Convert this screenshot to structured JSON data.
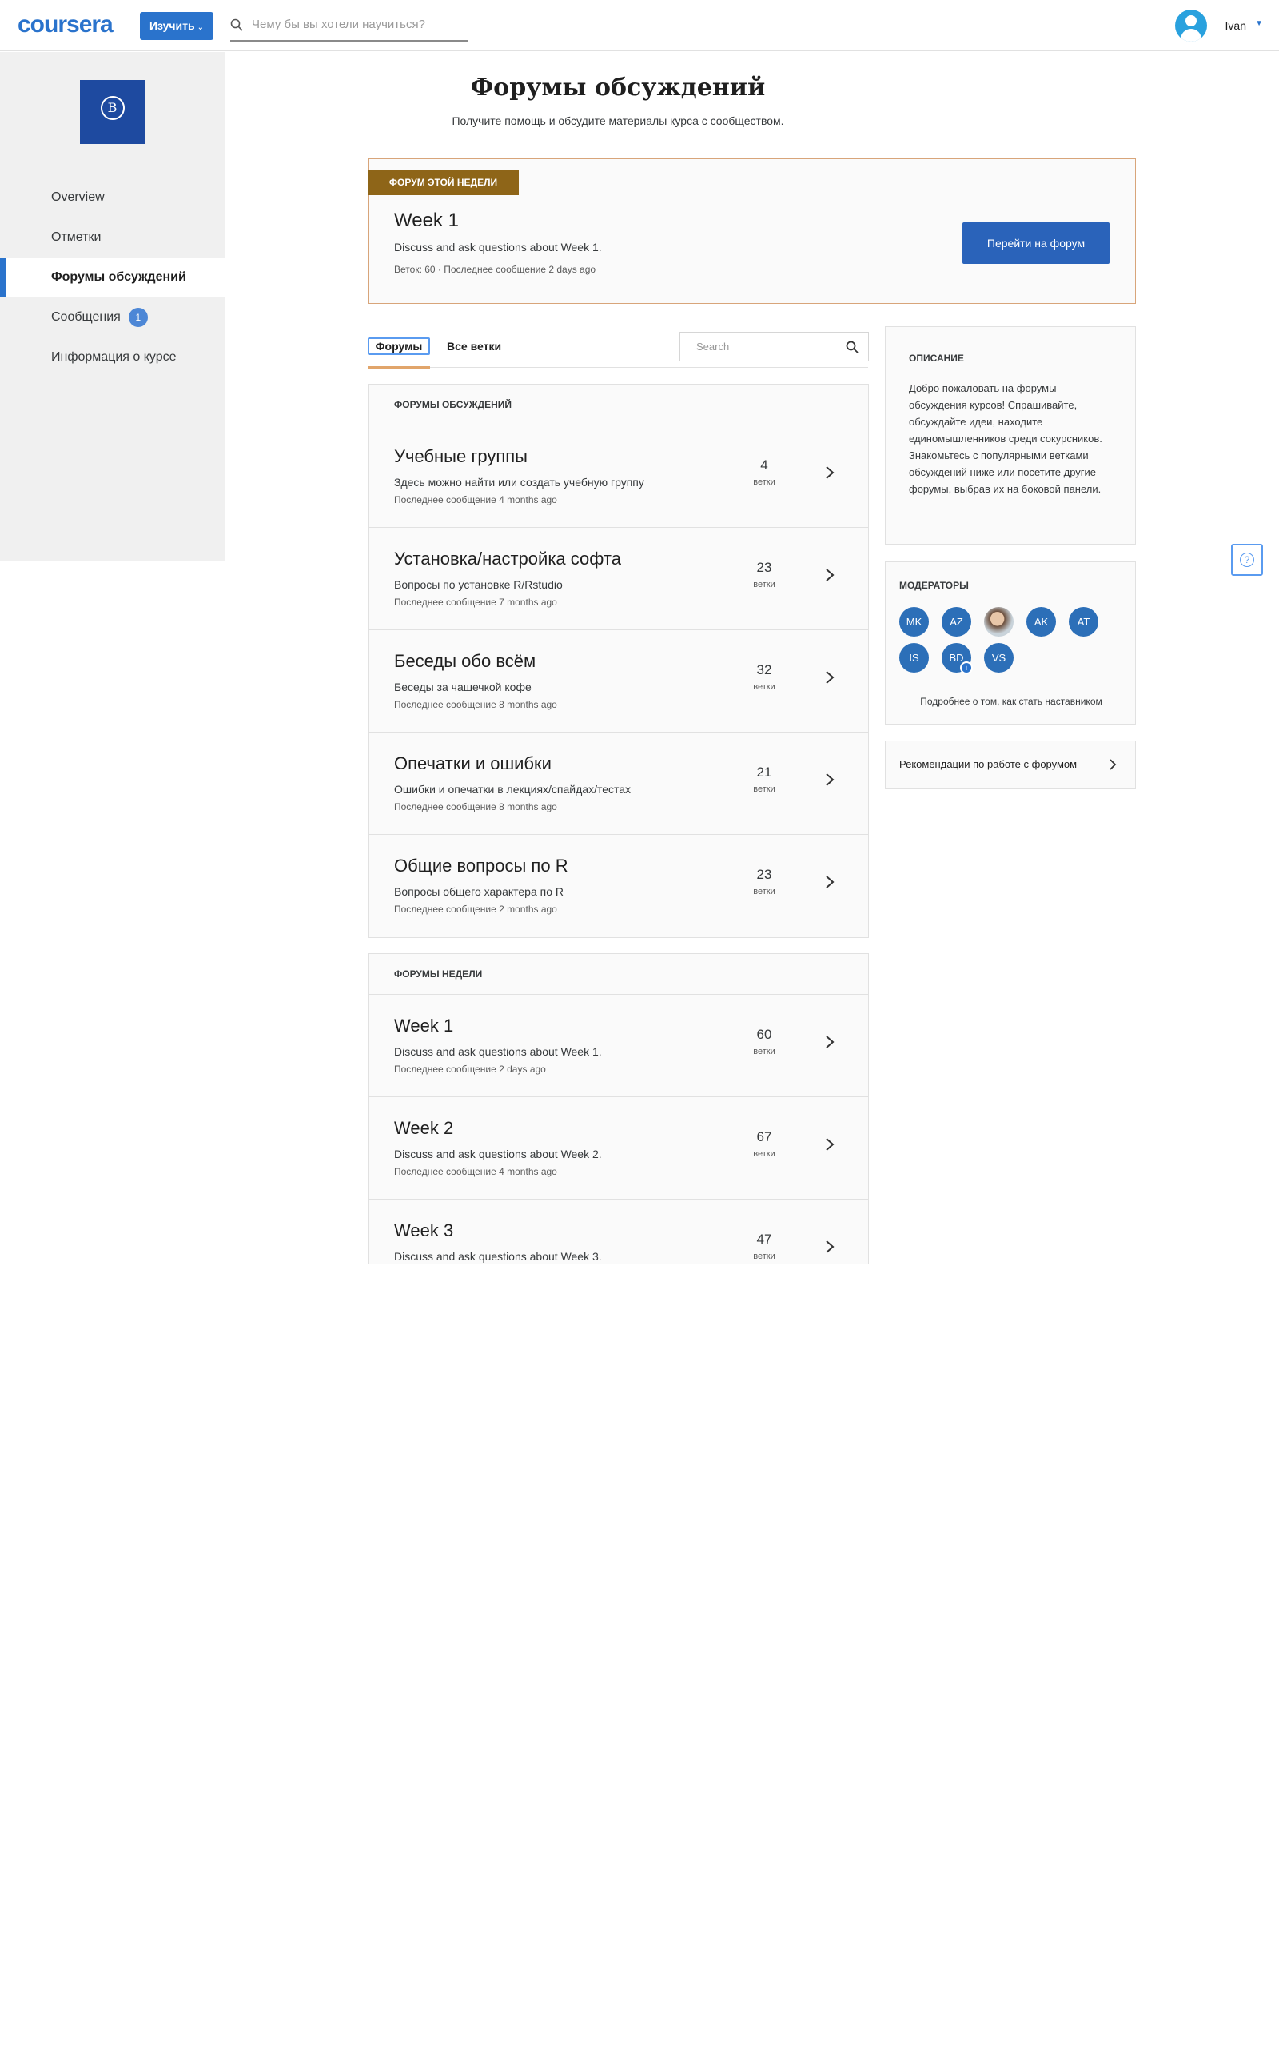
{
  "header": {
    "logo": "coursera",
    "explore_label": "Изучить",
    "search_placeholder": "Чему бы вы хотели научиться?",
    "user_name": "Ivan"
  },
  "sidebar": {
    "items": [
      {
        "label": "Overview"
      },
      {
        "label": "Отметки"
      },
      {
        "label": "Форумы обсуждений"
      },
      {
        "label": "Сообщения",
        "badge": "1"
      },
      {
        "label": "Информация о курсе"
      }
    ]
  },
  "main": {
    "title": "Форумы обсуждений",
    "subtitle": "Получите помощь и обсудите материалы курса с сообществом."
  },
  "featured": {
    "tag": "ФОРУМ ЭТОЙ НЕДЕЛИ",
    "title": "Week 1",
    "desc": "Discuss and ask questions about Week 1.",
    "meta": "Веток: 60 · Последнее сообщение 2 days ago",
    "button": "Перейти на форум"
  },
  "tabs": {
    "forums": "Форумы",
    "all_threads": "Все ветки",
    "search_placeholder": "Search"
  },
  "discussion_forums": {
    "header": "ФОРУМЫ ОБСУЖДЕНИЙ",
    "items": [
      {
        "title": "Учебные группы",
        "desc": "Здесь можно найти или создать учебную группу",
        "meta": "Последнее сообщение 4 months ago",
        "count": "4",
        "unit": "ветки"
      },
      {
        "title": "Установка/настройка софта",
        "desc": "Вопросы по установке R/Rstudio",
        "meta": "Последнее сообщение 7 months ago",
        "count": "23",
        "unit": "ветки"
      },
      {
        "title": "Беседы обо всём",
        "desc": "Беседы за чашечкой кофе",
        "meta": "Последнее сообщение 8 months ago",
        "count": "32",
        "unit": "ветки"
      },
      {
        "title": "Опечатки и ошибки",
        "desc": "Ошибки и опечатки в лекциях/спайдах/тестах",
        "meta": "Последнее сообщение 8 months ago",
        "count": "21",
        "unit": "ветки"
      },
      {
        "title": "Общие вопросы по R",
        "desc": "Вопросы общего характера по R",
        "meta": "Последнее сообщение 2 months ago",
        "count": "23",
        "unit": "ветки"
      }
    ]
  },
  "week_forums": {
    "header": "ФОРУМЫ НЕДЕЛИ",
    "items": [
      {
        "title": "Week 1",
        "desc": "Discuss and ask questions about Week 1.",
        "meta": "Последнее сообщение 2 days ago",
        "count": "60",
        "unit": "ветки"
      },
      {
        "title": "Week 2",
        "desc": "Discuss and ask questions about Week 2.",
        "meta": "Последнее сообщение 4 months ago",
        "count": "67",
        "unit": "ветки"
      },
      {
        "title": "Week 3",
        "desc": "Discuss and ask questions about Week 3.",
        "meta": "",
        "count": "47",
        "unit": "ветки"
      }
    ]
  },
  "description": {
    "header": "ОПИСАНИЕ",
    "text": "Добро пожаловать на форумы обсуждения курсов! Спрашивайте, обсуждайте идеи, находите единомышленников среди сокурсников. Знакомьтесь с популярными ветками обсуждений ниже или посетите другие форумы, выбрав их на боковой панели."
  },
  "moderators": {
    "header": "МОДЕРАТОРЫ",
    "list": [
      "MK",
      "AZ",
      "",
      "AK",
      "AT",
      "IS",
      "BD",
      "VS"
    ],
    "bd_badge": "i",
    "link": "Подробнее о том, как стать наставником"
  },
  "guidelines": {
    "label": "Рекомендации по работе с форумом"
  },
  "colors": {
    "brand": "#2a73cc",
    "featured_tag": "#8e6518",
    "featured_border": "#d8a57a"
  }
}
